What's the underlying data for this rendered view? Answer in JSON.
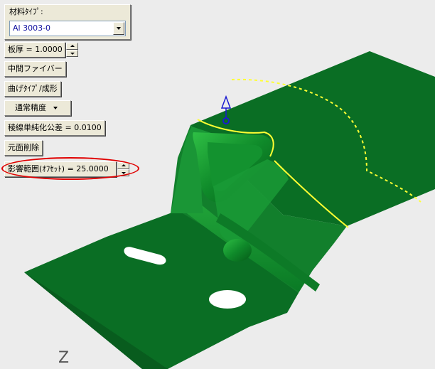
{
  "panel": {
    "material": {
      "label": "材料ﾀｲﾌﾟ:",
      "value": "Al 3003-0"
    },
    "thickness": {
      "label": "板厚 =",
      "value": "1.0000"
    },
    "buttons": {
      "middle_fiber": "中間ファイバー",
      "bend_type": "曲げﾀｲﾌﾟ/成形",
      "precision": "通常精度",
      "ridge_simplify": "稜線単純化公差 =",
      "ridge_simplify_value": "0.0100",
      "delete_face": "元面削除"
    },
    "influence": {
      "label": "影響範囲(ｵﾌｾｯﾄ) =",
      "value": "25.0000"
    }
  },
  "viewport": {
    "axis_label": "Z"
  },
  "colors": {
    "panel_bg": "#ece9d8",
    "model_green": "#0a6e24",
    "model_light_green": "#1ea43a",
    "boundary_yellow": "#ffff33",
    "highlight_red": "#e00000",
    "handle_blue": "#1a1ad0"
  }
}
